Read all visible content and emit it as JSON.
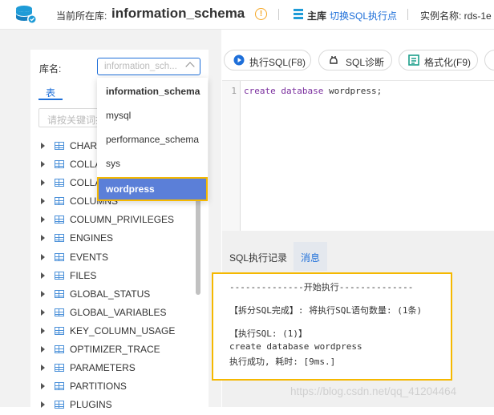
{
  "header": {
    "current_db_label": "当前所在库:",
    "current_db": "information_schema",
    "main_label": "主库",
    "switch_link": "切换SQL执行点",
    "instance_label": "实例名称: rds-1e"
  },
  "left": {
    "lib_label": "库名:",
    "lib_select_value": "information_sch...",
    "tab_table": "表",
    "search_placeholder": "请按关键词搜",
    "tree_items": [
      "CHARACTER_SETS",
      "COLLATIONS",
      "COLLATION_CHARACTER_SET_APPLICABILITY",
      "COLUMNS",
      "COLUMN_PRIVILEGES",
      "ENGINES",
      "EVENTS",
      "FILES",
      "GLOBAL_STATUS",
      "GLOBAL_VARIABLES",
      "KEY_COLUMN_USAGE",
      "OPTIMIZER_TRACE",
      "PARAMETERS",
      "PARTITIONS",
      "PLUGINS"
    ],
    "tree_visible": [
      "CHAR",
      "COLLA",
      "COLLA",
      "COLUMNS",
      "COLUMN_PRIVILEGES",
      "ENGINES",
      "EVENTS",
      "FILES",
      "GLOBAL_STATUS",
      "GLOBAL_VARIABLES",
      "KEY_COLUMN_USAGE",
      "OPTIMIZER_TRACE",
      "PARAMETERS",
      "PARTITIONS",
      "PLUGINS"
    ]
  },
  "dropdown": {
    "options": [
      "information_schema",
      "mysql",
      "performance_schema",
      "sys",
      "wordpress"
    ],
    "selected": "wordpress"
  },
  "toolbar": {
    "execute": "执行SQL(F8)",
    "diagnose": "SQL诊断",
    "format": "格式化(F9)"
  },
  "editor": {
    "line_number": "1",
    "code_kw1": "create",
    "code_kw2": "database",
    "code_rest": " wordpress;"
  },
  "result_tabs": {
    "history": "SQL执行记录",
    "messages": "消息"
  },
  "result": {
    "line1": "--------------开始执行--------------",
    "line2": "【拆分SQL完成】: 将执行SQL语句数量: (1条)",
    "line3": "【执行SQL: (1)】",
    "line4": "create database wordpress",
    "line5": "执行成功, 耗时: [9ms.]"
  },
  "watermark": "https://blog.csdn.net/qq_41204464",
  "colors": {
    "accent": "#1e6fd9",
    "highlight_border": "#f5b800",
    "selected_bg": "#5b7fd8",
    "keyword": "#7a2e9e"
  }
}
